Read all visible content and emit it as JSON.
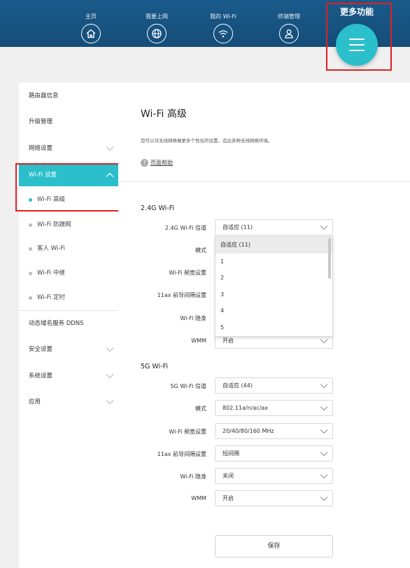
{
  "header": {
    "nav": [
      {
        "label": "主页",
        "icon": "home-icon"
      },
      {
        "label": "我要上网",
        "icon": "globe-icon"
      },
      {
        "label": "我的 Wi-Fi",
        "icon": "wifi-icon"
      },
      {
        "label": "终端管理",
        "icon": "user-icon"
      }
    ],
    "more_label": "更多功能",
    "more_icon": "menu-icon"
  },
  "sidebar": {
    "items": [
      {
        "label": "路由器信息"
      },
      {
        "label": "升级管理"
      },
      {
        "label": "网络设置"
      },
      {
        "label": "Wi-Fi 设置"
      },
      {
        "label": "Wi-Fi 高级"
      },
      {
        "label": "Wi-Fi 防蹭网"
      },
      {
        "label": "客人 Wi-Fi"
      },
      {
        "label": "Wi-Fi 中继"
      },
      {
        "label": "Wi-Fi 定时"
      },
      {
        "label": "动态域名服务 DDNS"
      },
      {
        "label": "安全设置"
      },
      {
        "label": "系统设置"
      },
      {
        "label": "应用"
      }
    ]
  },
  "main": {
    "title": "Wi-Fi 高级",
    "description": "您可以对无线网络做更多个性化的设置，造出各种无线网络环境。",
    "help_link": "页面帮助",
    "section_24g": {
      "title": "2.4G Wi-Fi",
      "channel_label": "2.4G Wi-Fi 信道",
      "channel_value": "自适应 (11)",
      "mode_label": "模式",
      "bandwidth_label": "Wi-Fi 频宽设置",
      "guard_label": "11ax 前导间隔设置",
      "hidden_label": "Wi-Fi 隐身",
      "wmm_label": "WMM",
      "wmm_value": "开启"
    },
    "channel_dropdown": {
      "options": [
        "自适应 (11)",
        "1",
        "2",
        "3",
        "4",
        "5"
      ],
      "selected": "自适应 (11)"
    },
    "section_5g": {
      "title": "5G Wi-Fi",
      "channel_label": "5G Wi-Fi 信道",
      "channel_value": "自适应 (44)",
      "mode_label": "模式",
      "mode_value": "802.11a/n/ac/ax",
      "bandwidth_label": "Wi-Fi 频宽设置",
      "bandwidth_value": "20/40/80/160 MHz",
      "guard_label": "11ax 前导间隔设置",
      "guard_value": "短间隔",
      "hidden_label": "Wi-Fi 隐身",
      "hidden_value": "关闭",
      "wmm_label": "WMM",
      "wmm_value": "开启"
    },
    "save_label": "保存"
  },
  "colors": {
    "header_bg": "#1a5a8a",
    "accent": "#2bbfcb",
    "annotation_red": "#e02020"
  }
}
